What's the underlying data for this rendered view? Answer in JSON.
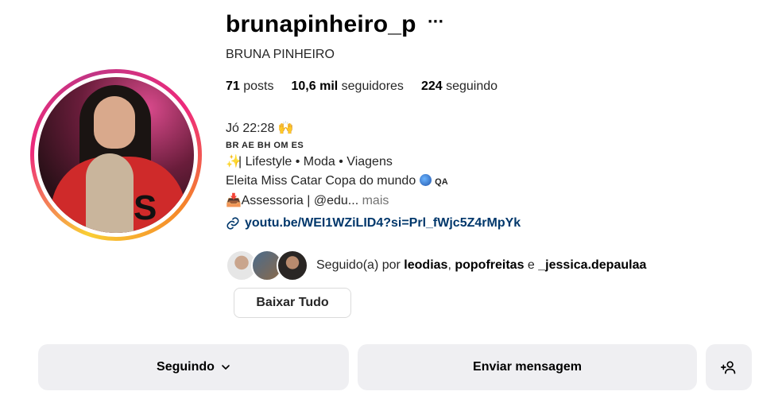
{
  "profile": {
    "username": "brunapinheiro_p",
    "more_label": "···",
    "full_name": "BRUNA PINHEIRO"
  },
  "stats": {
    "posts_count": "71",
    "posts_label": "posts",
    "followers_count": "10,6 mil",
    "followers_label": "seguidores",
    "following_count": "224",
    "following_label": "seguindo"
  },
  "bio": {
    "line1_text": "Jó 22:28",
    "line1_emoji": "🙌",
    "flags": "BR AE BH OM ES",
    "line3_emoji": "✨",
    "line3_text": "| Lifestyle • Moda • Viagens",
    "line4_text": "Eleita Miss Catar Copa do mundo",
    "line4_suffix": "QA",
    "line5_emoji": "📥",
    "line5_text": "Assessoria | @edu...",
    "more_label": "mais"
  },
  "link": {
    "text": "youtu.be/WEI1WZiLID4?si=Prl_fWjc5Z4rMpYk"
  },
  "followed_by": {
    "prefix": "Seguido(a) por",
    "user1": "leodias",
    "separator": ",",
    "user2": "popofreitas",
    "conjunction": "e",
    "user3": "_jessica.depaulaa"
  },
  "buttons": {
    "download": "Baixar Tudo",
    "following": "Seguindo",
    "message": "Enviar mensagem",
    "add_user_icon": "add-user-icon"
  },
  "colors": {
    "link": "#00376b",
    "button_bg": "#efeff2",
    "ring_start": "#f9ce34",
    "ring_mid": "#ee2a7b",
    "ring_end": "#c13584"
  }
}
